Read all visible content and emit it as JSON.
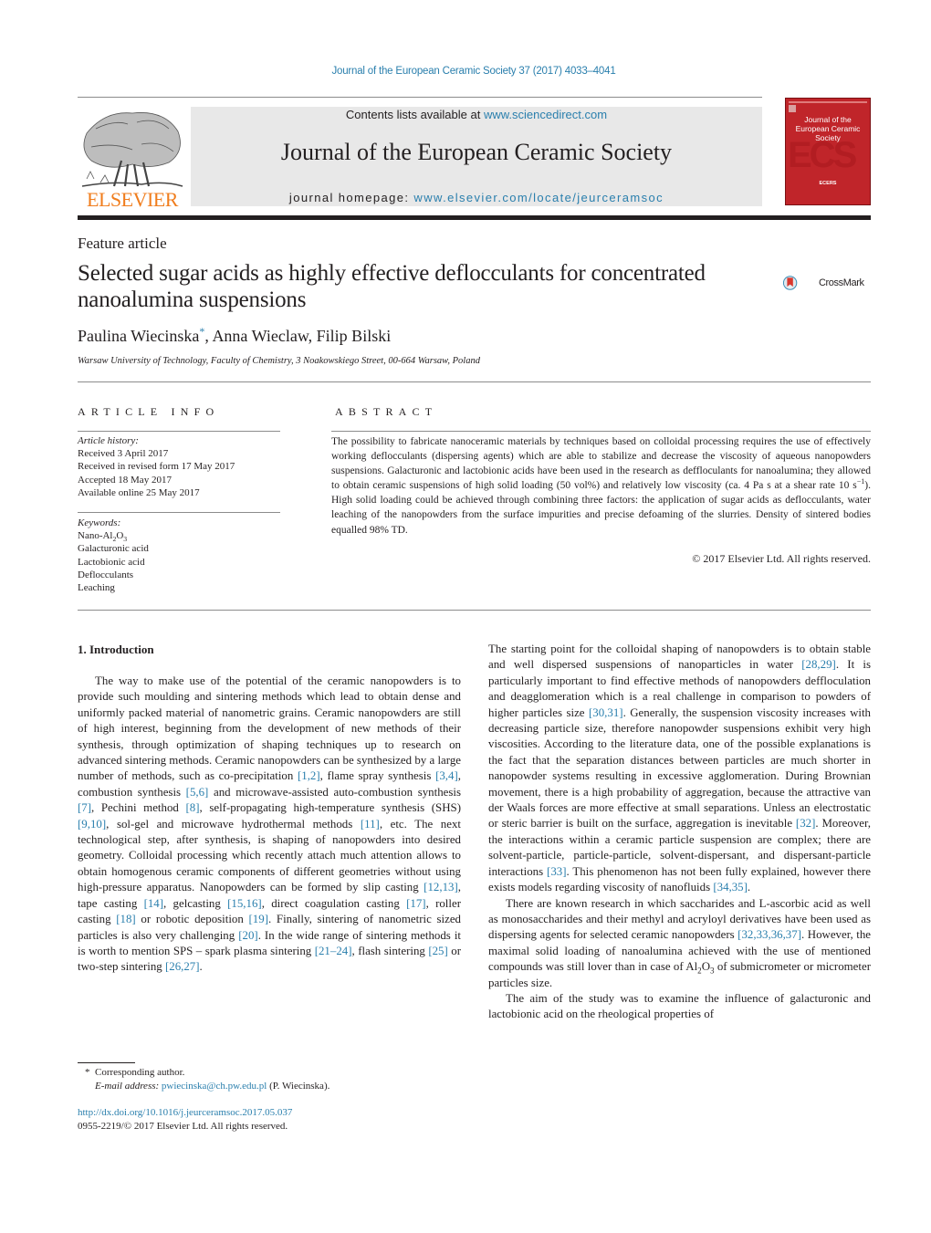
{
  "header": {
    "journal_ref": "Journal of the European Ceramic Society 37 (2017) 4033–4041",
    "publisher_name": "ELSEVIER",
    "contents_prefix": "Contents lists available at ",
    "contents_link": "www.sciencedirect.com",
    "journal_name": "Journal of the European Ceramic Society",
    "homepage_prefix": "journal homepage: ",
    "homepage_link": "www.elsevier.com/locate/jeurceramsoc",
    "cover": {
      "title_line1": "Journal of the",
      "title_line2": "European Ceramic Society",
      "letters": "ECS",
      "society": "ECERS"
    },
    "colors": {
      "link": "#2a7fad",
      "elsevier_orange": "#f07d1d",
      "cover_red": "#c0252a",
      "header_box_gray": "#e8e8e8"
    }
  },
  "article": {
    "type": "Feature article",
    "title": "Selected sugar acids as highly effective deflocculants for concentrated nanoalumina suspensions",
    "crossmark_label": "CrossMark",
    "authors": [
      {
        "name": "Paulina Wiecinska",
        "corresponding": true
      },
      {
        "name": "Anna Wieclaw",
        "corresponding": false
      },
      {
        "name": "Filip Bilski",
        "corresponding": false
      }
    ],
    "author_sep": ", ",
    "corresponding_mark": "*",
    "affiliation": "Warsaw University of Technology, Faculty of Chemistry, 3 Noakowskiego Street, 00-664 Warsaw, Poland"
  },
  "article_info": {
    "heading": "ARTICLE INFO",
    "history_label": "Article history:",
    "history": [
      "Received 3 April 2017",
      "Received in revised form 17 May 2017",
      "Accepted 18 May 2017",
      "Available online 25 May 2017"
    ],
    "keywords_label": "Keywords:",
    "keywords": [
      "Nano-Al2O3",
      "Galacturonic acid",
      "Lactobionic acid",
      "Deflocculants",
      "Leaching"
    ]
  },
  "abstract": {
    "heading": "ABSTRACT",
    "text_part1": "The possibility to fabricate nanoceramic materials by techniques based on colloidal processing requires the use of effectively working deflocculants (dispersing agents) which are able to stabilize and decrease the viscosity of aqueous nanopowders suspensions. Galacturonic and lactobionic acids have been used in the research as deffloculants for nanoalumina; they allowed to obtain ceramic suspensions of high solid loading (50 vol%) and relatively low viscosity (ca. 4 Pa s at a shear rate 10 s",
    "text_sup": "−1",
    "text_part2": "). High solid loading could be achieved through combining three factors: the application of sugar acids as deflocculants, water leaching of the nanopowders from the surface impurities and precise defoaming of the slurries. Density of sintered bodies equalled 98% TD.",
    "copyright": "© 2017 Elsevier Ltd. All rights reserved."
  },
  "body": {
    "section_heading": "1.  Introduction",
    "left_paragraph": [
      {
        "t": "The way to make use of the potential of the ceramic nanopowders is to provide such moulding and sintering methods which lead to obtain dense and uniformly packed material of nanometric grains. Ceramic nanopowders are still of high interest, beginning from the development of new methods of their synthesis, through optimization of shaping techniques up to research on advanced sintering methods. Ceramic nanopowders can be synthesized by a large number of methods, such as co-precipitation "
      },
      {
        "c": "[1,2]"
      },
      {
        "t": ", flame spray synthesis "
      },
      {
        "c": "[3,4]"
      },
      {
        "t": ", combustion synthesis "
      },
      {
        "c": "[5,6]"
      },
      {
        "t": " and microwave-assisted auto-combustion synthesis "
      },
      {
        "c": "[7]"
      },
      {
        "t": ", Pechini method "
      },
      {
        "c": "[8]"
      },
      {
        "t": ", self-propagating high-temperature synthesis (SHS) "
      },
      {
        "c": "[9,10]"
      },
      {
        "t": ", sol-gel and microwave hydrothermal methods "
      },
      {
        "c": "[11]"
      },
      {
        "t": ", etc. The next technological step, after synthesis, is shaping of nanopowders into desired geometry. Colloidal processing which recently attach much attention allows to obtain homogenous ceramic components of different geometries without using high-pressure apparatus. Nanopowders can be formed by slip casting "
      },
      {
        "c": "[12,13]"
      },
      {
        "t": ", tape casting "
      },
      {
        "c": "[14]"
      },
      {
        "t": ", gelcasting "
      },
      {
        "c": "[15,16]"
      },
      {
        "t": ", direct coagulation casting "
      },
      {
        "c": "[17]"
      },
      {
        "t": ", roller casting "
      },
      {
        "c": "[18]"
      },
      {
        "t": " or robotic deposition "
      },
      {
        "c": "[19]"
      },
      {
        "t": ". Finally, sintering of nanometric sized particles is also very challenging "
      },
      {
        "c": "[20]"
      },
      {
        "t": ". In the wide range of sintering methods it is worth to mention SPS – spark plasma sintering "
      },
      {
        "c": "[21–24]"
      },
      {
        "t": ", flash sintering "
      },
      {
        "c": "[25]"
      },
      {
        "t": " or two-step sintering "
      },
      {
        "c": "[26,27]"
      },
      {
        "t": "."
      }
    ],
    "right_paragraph1": [
      {
        "t": "The starting point for the colloidal shaping of nanopowders is to obtain stable and well dispersed suspensions of nanoparticles in water "
      },
      {
        "c": "[28,29]"
      },
      {
        "t": ". It is particularly important to find effective methods of nanopowders deffloculation and deagglomeration which is a real challenge in comparison to powders of higher particles size "
      },
      {
        "c": "[30,31]"
      },
      {
        "t": ". Generally, the suspension viscosity increases with decreasing particle size, therefore nanopowder suspensions exhibit very high viscosities. According to the literature data, one of the possible explanations is the fact that the separation distances between particles are much shorter in nanopowder systems resulting in excessive agglomeration. During Brownian movement, there is a high probability of aggregation, because the attractive van der Waals forces are more effective at small separations. Unless an electrostatic or steric barrier is built on the surface, aggregation is inevitable "
      },
      {
        "c": "[32]"
      },
      {
        "t": ". Moreover, the interactions within a ceramic particle suspension are complex; there are solvent-particle, particle-particle, solvent-dispersant, and dispersant-particle interactions "
      },
      {
        "c": "[33]"
      },
      {
        "t": ". This phenomenon has not been fully explained, however there exists models regarding viscosity of nanofluids "
      },
      {
        "c": "[34,35]"
      },
      {
        "t": "."
      }
    ],
    "right_paragraph2": [
      {
        "t": "There are known research in which saccharides and L-ascorbic acid as well as monosaccharides and their methyl and acryloyl derivatives have been used as dispersing agents for selected ceramic nanopowders "
      },
      {
        "c": "[32,33,36,37]"
      },
      {
        "t": ". However, the maximal solid loading of nanoalumina achieved with the use of mentioned compounds was still lover than in case of Al"
      },
      {
        "sub": "2"
      },
      {
        "t": "O"
      },
      {
        "sub": "3"
      },
      {
        "t": " of submicrometer or micrometer particles size."
      }
    ],
    "right_paragraph3": [
      {
        "t": "The aim of the study was to examine the influence of galacturonic and lactobionic acid on the rheological properties of"
      }
    ]
  },
  "footer": {
    "corresponding_note": "Corresponding author.",
    "email_label": "E-mail address:",
    "email": "pwiecinska@ch.pw.edu.pl",
    "email_suffix": " (P. Wiecinska).",
    "doi": "http://dx.doi.org/10.1016/j.jeurceramsoc.2017.05.037",
    "issn_line": "0955-2219/© 2017 Elsevier Ltd. All rights reserved."
  }
}
